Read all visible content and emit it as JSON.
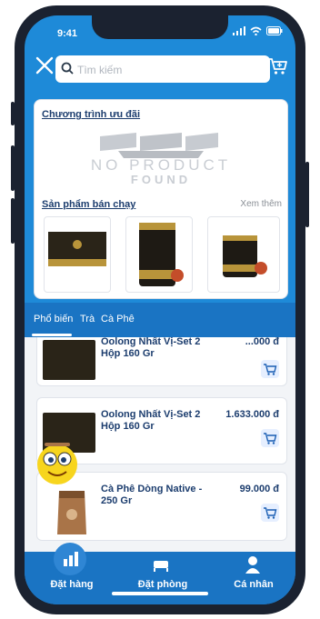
{
  "status": {
    "time": "9:41"
  },
  "search": {
    "placeholder": "Tìm kiếm"
  },
  "promo": {
    "title": "Chương trình ưu đãi",
    "no_product_line1": "NO PRODUCT",
    "no_product_line2": "FOUND"
  },
  "bestsellers": {
    "title": "Sản phẩm bán chạy",
    "more": "Xem thêm"
  },
  "tabs": [
    {
      "label": "Phổ biến"
    },
    {
      "label": "Trà"
    },
    {
      "label": "Cà Phê"
    }
  ],
  "products": [
    {
      "name": "Oolong Nhất Vị-Set 2 Hộp 160 Gr",
      "price": "...000 đ"
    },
    {
      "name": "Oolong Nhất Vị-Set 2 Hộp 160 Gr",
      "price": "1.633.000 đ"
    },
    {
      "name": "Cà Phê Dòng Native - 250 Gr",
      "price": "99.000 đ"
    }
  ],
  "bottom_nav": [
    {
      "label": "Đặt hàng",
      "icon": "order-icon"
    },
    {
      "label": "Đặt phòng",
      "icon": "room-icon"
    },
    {
      "label": "Cá nhân",
      "icon": "person-icon"
    }
  ],
  "colors": {
    "primary": "#1e8ad8",
    "nav": "#1a74c3",
    "text": "#1c3d6e"
  }
}
